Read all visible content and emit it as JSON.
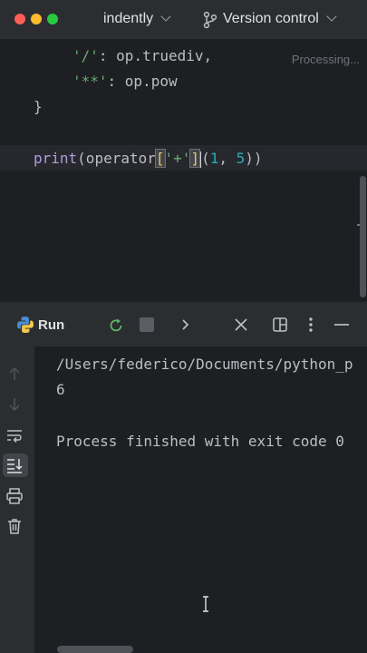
{
  "titlebar": {
    "project_name": "indently",
    "vcs_label": "Version control"
  },
  "editor": {
    "status": "Processing...",
    "lines": [
      {
        "key": "'/'",
        "sep": ": ",
        "val": "op.truediv,"
      },
      {
        "key": "'**'",
        "sep": ": ",
        "val": "op.pow"
      },
      {
        "text": "}"
      },
      {
        "fn": "print",
        "a": "(operator",
        "b1": "[",
        "s": "'+'",
        "b2": "]",
        "c": "(",
        "n1": "1",
        "d": ", ",
        "n2": "5",
        "e": "))"
      }
    ]
  },
  "run": {
    "title": "Run",
    "console": [
      "/Users/federico/Documents/python_p",
      "6",
      "",
      "Process finished with exit code 0"
    ]
  },
  "icons": {
    "python": "python-icon",
    "rerun": "rerun-icon",
    "stop": "stop-icon",
    "more": "chevron-right-icon",
    "close": "close-icon",
    "layout": "layout-icon",
    "kebab": "more-vertical-icon",
    "minimize": "minimize-icon"
  }
}
